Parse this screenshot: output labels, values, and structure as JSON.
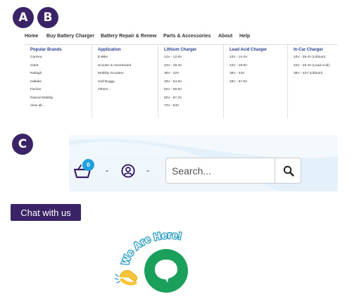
{
  "badges": {
    "a": "A",
    "b": "B",
    "c": "C"
  },
  "nav": {
    "items": [
      "Home",
      "Buy Battery Charger",
      "Battery Repair & Renew",
      "Parts & Accessories",
      "About",
      "Help"
    ]
  },
  "mega_menu": {
    "columns": [
      {
        "title": "Popular Brands",
        "items": [
          "Carrera",
          "Giant",
          "Raleigh",
          "Halbike",
          "Fischer",
          "Rascal Mobility",
          "View all..."
        ]
      },
      {
        "title": "Application",
        "items": [
          "E-Bike",
          "Scooter & Hoverboard",
          "Mobility Scooters",
          "Golf Buggy",
          "Others..."
        ]
      },
      {
        "title": "Lithium Charger",
        "items": [
          "12V - 12.6V",
          "24V - 29.4V",
          "36V - 42V",
          "48V - 54.6V",
          "52V - 58.8V",
          "60V - 67.2V",
          "72V - 84V"
        ]
      },
      {
        "title": "Lead Acid Charger",
        "items": [
          "12V - 14.4V",
          "24V - 28.9V",
          "36V - 44V",
          "48V - 57.6V"
        ]
      },
      {
        "title": "In-Car Charger",
        "items": [
          "24V - 29.4V (Lithium)",
          "24V - 29.4V (Lead Acid)",
          "36V - 42V (Lithium)"
        ]
      }
    ]
  },
  "header": {
    "cart_count": "0",
    "separator": "-",
    "search_placeholder": "Search..."
  },
  "chat": {
    "button_label": "Chat with us",
    "widget_text": "We Are Here!"
  },
  "colors": {
    "brand_purple": "#3a2467",
    "nav_blue": "#2b3f8f",
    "badge_blue": "#1fa0df",
    "chat_green": "#1aa05a"
  },
  "icons": [
    "basket-icon",
    "user-icon",
    "search-icon",
    "chat-bubble-icon",
    "waving-hand-icon"
  ]
}
